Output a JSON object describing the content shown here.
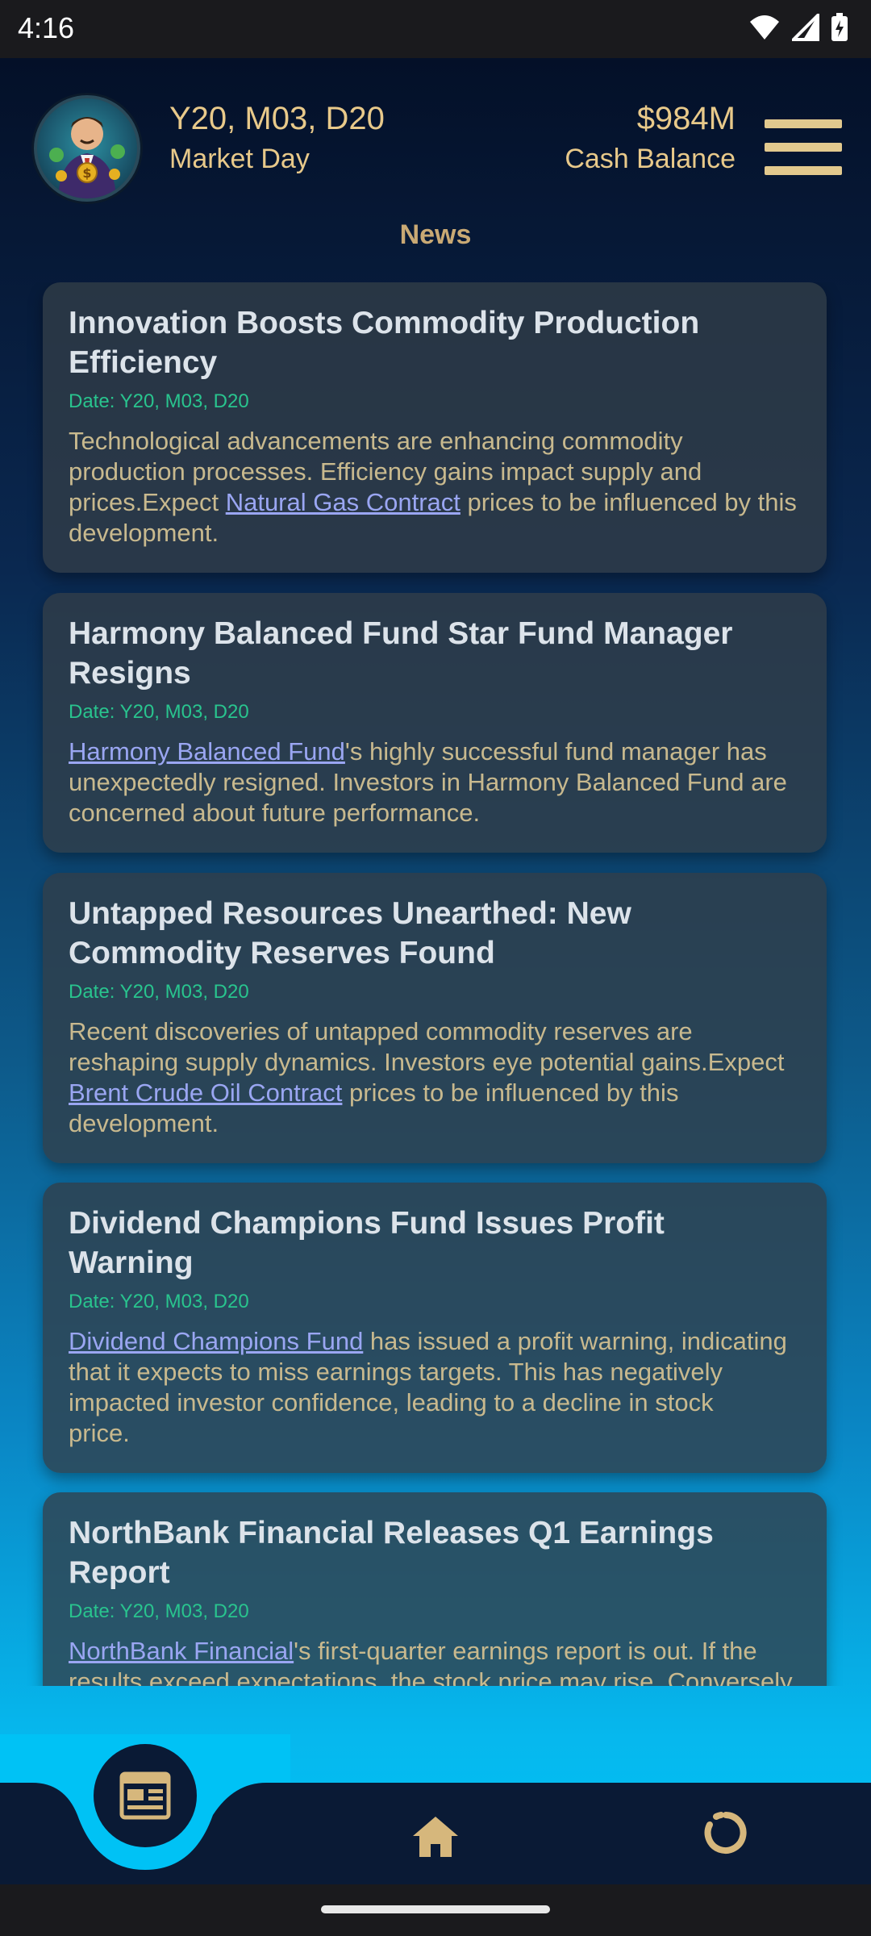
{
  "status_bar": {
    "time": "4:16"
  },
  "header": {
    "date": "Y20, M03, D20",
    "date_label": "Market Day",
    "cash": "$984M",
    "cash_label": "Cash Balance"
  },
  "section_title": "News",
  "news": [
    {
      "title_lines": [
        "Innovation Boosts Commodity Production",
        "Efficiency"
      ],
      "date": "Date: Y20, M03, D20",
      "line1": "Technological advancements are enhancing commodity",
      "line2": "production processes. Efficiency gains impact supply and",
      "line3_pre": "prices.Expect ",
      "link": "Natural Gas Contract",
      "line3_post": " prices to be influenced by this",
      "line4": "development."
    },
    {
      "title_lines": [
        "Harmony Balanced Fund Star Fund Manager",
        "Resigns"
      ],
      "date": "Date: Y20, M03, D20",
      "link": "Harmony Balanced Fund",
      "line1_post": "'s highly successful fund manager has",
      "line2": "unexpectedly resigned. Investors in Harmony Balanced Fund are",
      "line3": "concerned about future performance."
    },
    {
      "title_lines": [
        "Untapped Resources Unearthed: New",
        "Commodity Reserves Found"
      ],
      "date": "Date: Y20, M03, D20",
      "line1": "Recent discoveries of untapped commodity reserves are",
      "line2": "reshaping supply dynamics. Investors eye potential gains.Expect",
      "link": "Brent Crude Oil Contract",
      "line3_post": " prices to be influenced by this",
      "line4": "development."
    },
    {
      "title_lines": [
        "Dividend Champions Fund Issues Profit",
        "Warning"
      ],
      "date": "Date: Y20, M03, D20",
      "link": "Dividend Champions Fund",
      "line1_post": " has issued a profit warning, indicating",
      "line2": "that it expects to miss earnings targets. This has negatively",
      "line3": "impacted investor confidence, leading to a decline in stock",
      "line4": "price."
    },
    {
      "title_lines": [
        "NorthBank Financial Releases Q1 Earnings",
        "Report"
      ],
      "date": "Date: Y20, M03, D20",
      "link": "NorthBank Financial",
      "line1_post": "'s first-quarter earnings report is out. If the",
      "line2": "results exceed expectations, the stock price may rise. Conversely"
    }
  ],
  "bottom_nav": {
    "active": "news-icon",
    "items": [
      "news-icon",
      "home-icon",
      "loader-icon"
    ]
  },
  "colors": {
    "accent_gold": "#e8c98a",
    "date_green": "#29c48e",
    "link_blue": "#9aa6f2",
    "nav_bg": "#0a1a35"
  }
}
